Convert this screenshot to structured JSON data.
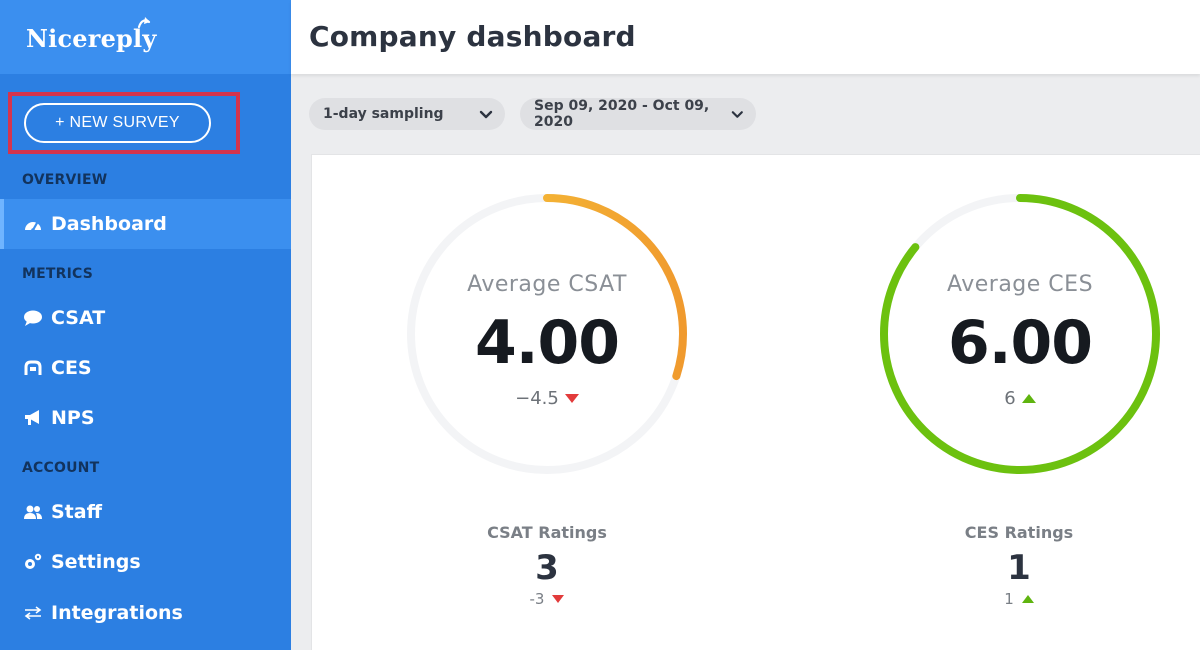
{
  "brand": {
    "name": "Nicereply"
  },
  "sidebar": {
    "new_survey_label": "+ NEW SURVEY",
    "sections": {
      "overview": "OVERVIEW",
      "metrics": "METRICS",
      "account": "ACCOUNT"
    },
    "items": [
      {
        "label": "Dashboard",
        "icon": "dashboard-gauge-icon",
        "active": true
      },
      {
        "label": "CSAT",
        "icon": "speech-bubble-icon"
      },
      {
        "label": "CES",
        "icon": "ces-handshake-icon"
      },
      {
        "label": "NPS",
        "icon": "megaphone-icon"
      },
      {
        "label": "Staff",
        "icon": "users-icon"
      },
      {
        "label": "Settings",
        "icon": "gears-icon"
      },
      {
        "label": "Integrations",
        "icon": "swap-arrows-icon"
      }
    ]
  },
  "header": {
    "title": "Company dashboard"
  },
  "filters": {
    "sampling": "1-day sampling",
    "date_range": "Sep 09, 2020 - Oct 09, 2020"
  },
  "metrics": {
    "csat": {
      "label": "Average CSAT",
      "value": "4.00",
      "delta": "−4.5",
      "trend": "down",
      "progress": 0.3
    },
    "ces": {
      "label": "Average CES",
      "value": "6.00",
      "delta": "6",
      "trend": "up",
      "progress": 0.86
    }
  },
  "ratings": {
    "csat": {
      "label": "CSAT Ratings",
      "count": "3",
      "delta": "-3",
      "trend": "down"
    },
    "ces": {
      "label": "CES Ratings",
      "count": "1",
      "delta": "1",
      "trend": "up"
    }
  },
  "colors": {
    "sidebar": "#2c7fe2",
    "accent": "#3b8fef",
    "csat_gradient_start": "#f7c93b",
    "csat_gradient_end": "#f09a2e",
    "ces_green": "#6cc10f",
    "down_red": "#e23b3b",
    "up_green": "#5fb40f"
  }
}
